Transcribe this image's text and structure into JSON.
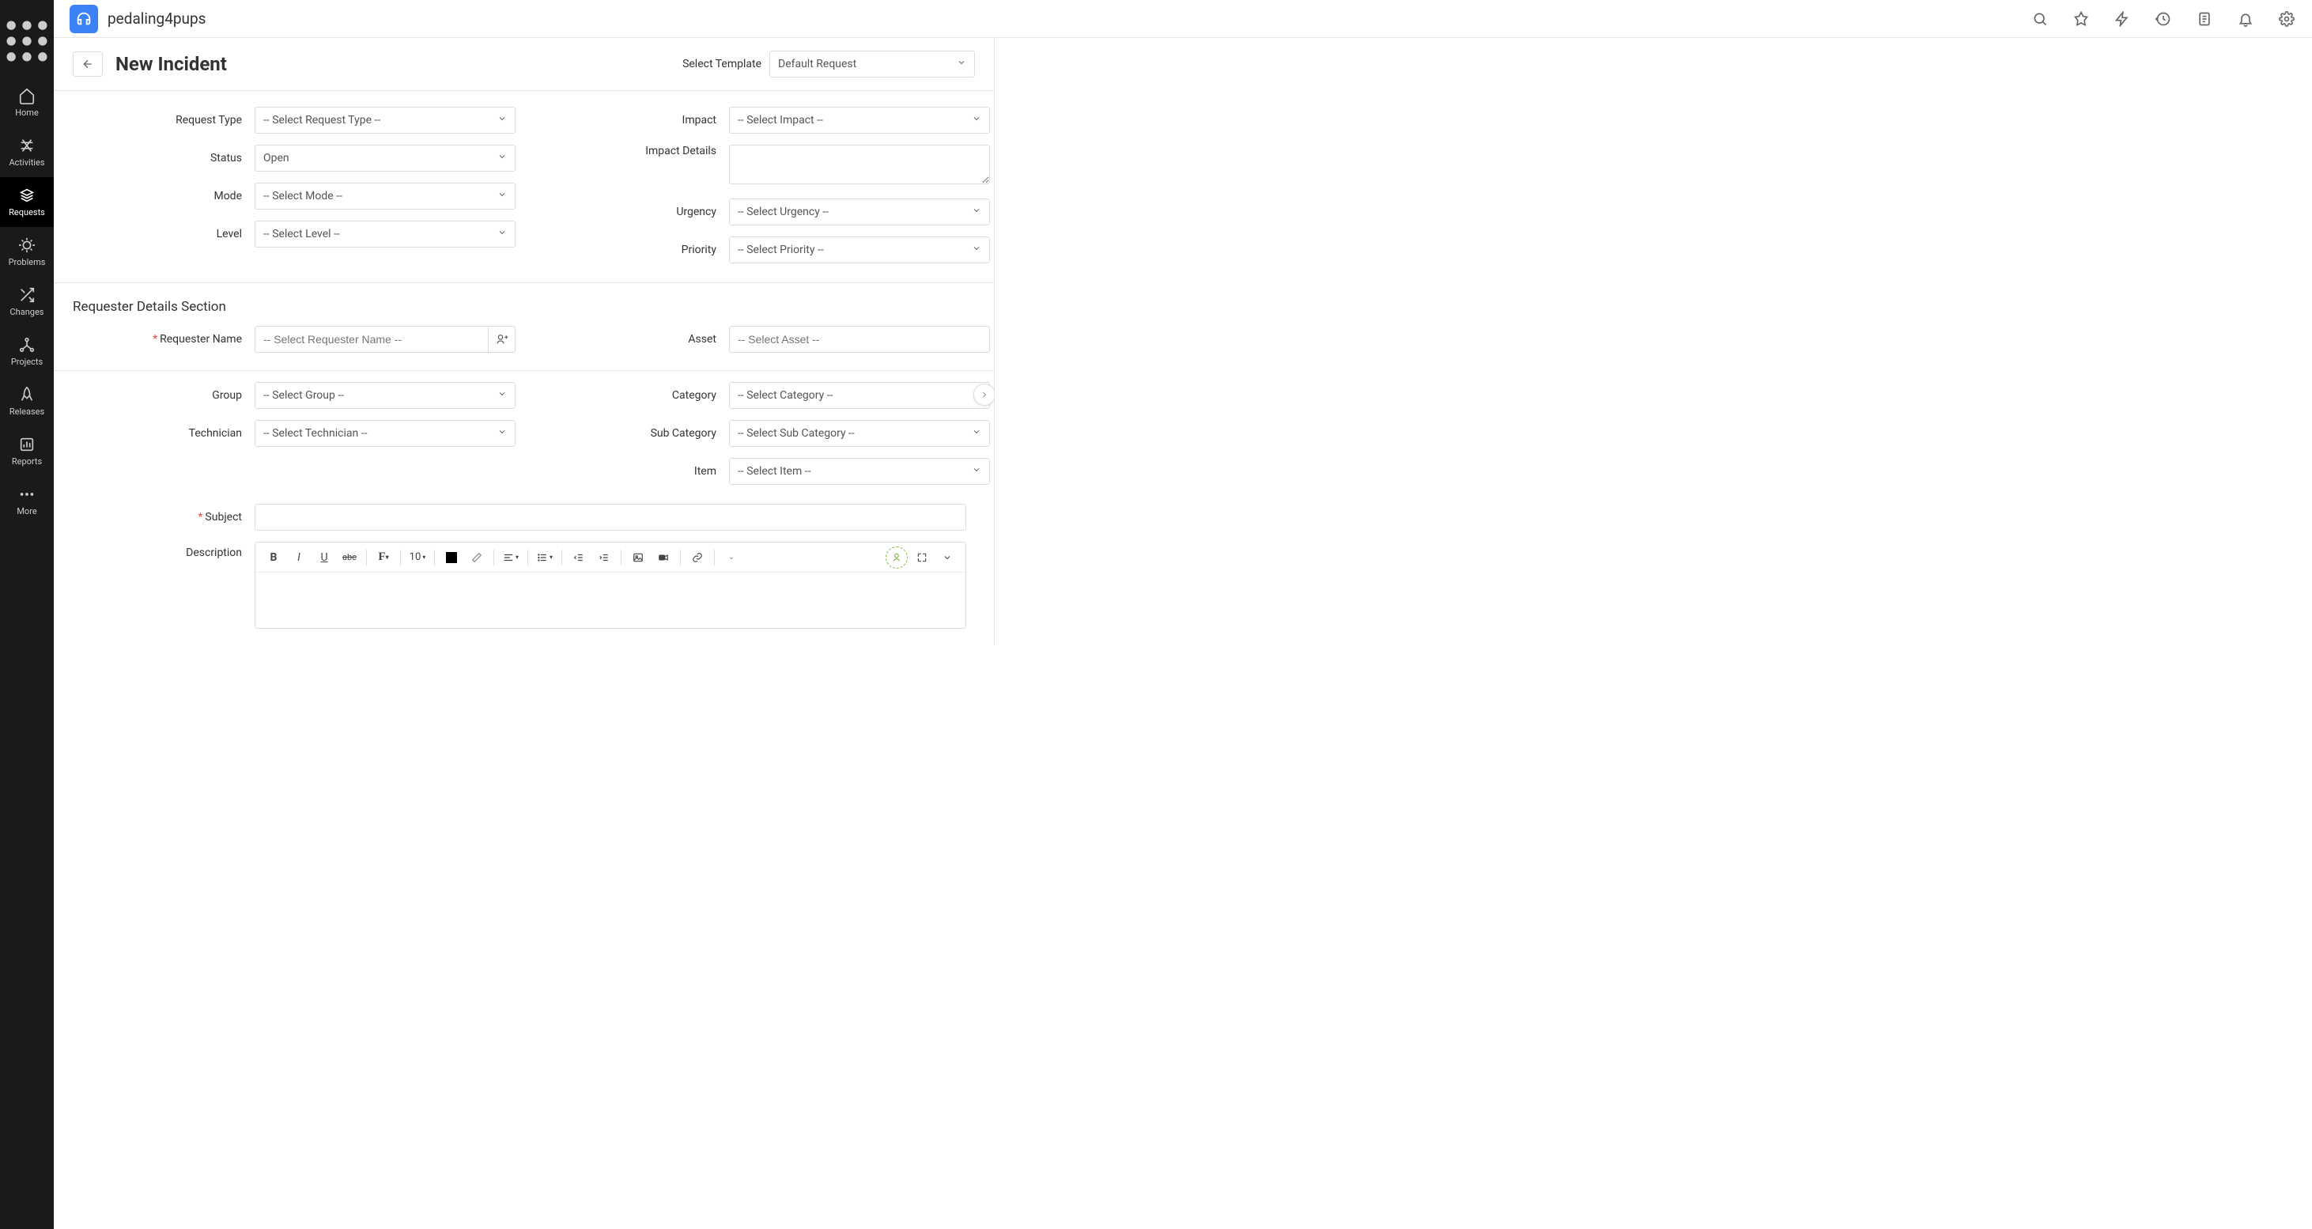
{
  "app": {
    "name": "pedaling4pups"
  },
  "sidebar": {
    "items": [
      {
        "label": "Home"
      },
      {
        "label": "Activities"
      },
      {
        "label": "Requests"
      },
      {
        "label": "Problems"
      },
      {
        "label": "Changes"
      },
      {
        "label": "Projects"
      },
      {
        "label": "Releases"
      },
      {
        "label": "Reports"
      },
      {
        "label": "More"
      }
    ]
  },
  "page": {
    "title": "New Incident",
    "template_label": "Select Template",
    "template_value": "Default Request"
  },
  "form": {
    "request_type": {
      "label": "Request Type",
      "value": "-- Select Request Type --"
    },
    "status": {
      "label": "Status",
      "value": "Open"
    },
    "mode": {
      "label": "Mode",
      "value": "-- Select Mode --"
    },
    "level": {
      "label": "Level",
      "value": "-- Select Level --"
    },
    "impact": {
      "label": "Impact",
      "value": "-- Select Impact --"
    },
    "impact_details": {
      "label": "Impact Details",
      "value": ""
    },
    "urgency": {
      "label": "Urgency",
      "value": "-- Select Urgency --"
    },
    "priority": {
      "label": "Priority",
      "value": "-- Select Priority --"
    },
    "requester_section": "Requester Details Section",
    "requester_name": {
      "label": "Requester Name",
      "placeholder": "-- Select Requester Name --"
    },
    "asset": {
      "label": "Asset",
      "placeholder": "-- Select Asset --"
    },
    "group": {
      "label": "Group",
      "value": "-- Select Group --"
    },
    "technician": {
      "label": "Technician",
      "value": "-- Select Technician --"
    },
    "category": {
      "label": "Category",
      "value": "-- Select Category --"
    },
    "sub_category": {
      "label": "Sub Category",
      "value": "-- Select Sub Category --"
    },
    "item": {
      "label": "Item",
      "value": "-- Select Item --"
    },
    "subject": {
      "label": "Subject",
      "value": ""
    },
    "description": {
      "label": "Description"
    },
    "editor": {
      "font_size": "10"
    }
  }
}
